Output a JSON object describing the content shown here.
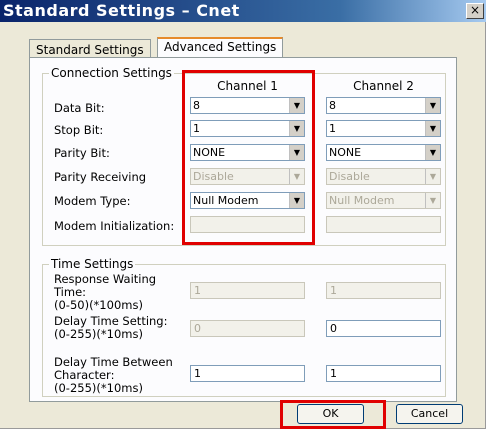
{
  "window": {
    "title": "Standard Settings – Cnet",
    "close_glyph": "×"
  },
  "tabs": [
    {
      "label": "Standard Settings",
      "selected": false
    },
    {
      "label": "Advanced Settings",
      "selected": true
    }
  ],
  "connection": {
    "group_title": "Connection Settings",
    "channel1_header": "Channel 1",
    "channel2_header": "Channel 2",
    "labels": {
      "data_bit": "Data Bit:",
      "stop_bit": "Stop Bit:",
      "parity_bit": "Parity Bit:",
      "parity_receiving": "Parity Receiving",
      "modem_type": "Modem Type:",
      "modem_init": "Modem Initialization:"
    },
    "channel1": {
      "data_bit": "8",
      "stop_bit": "1",
      "parity_bit": "NONE",
      "parity_receiving": "Disable",
      "modem_type": "Null Modem",
      "modem_init": ""
    },
    "channel2": {
      "data_bit": "8",
      "stop_bit": "1",
      "parity_bit": "NONE",
      "parity_receiving": "Disable",
      "modem_type": "Null Modem",
      "modem_init": ""
    }
  },
  "time": {
    "group_title": "Time Settings",
    "labels": {
      "response_waiting": "Response Waiting Time:\n(0-50)(*100ms)",
      "delay_time": "Delay Time Setting:\n(0-255)(*10ms)",
      "delay_between_char": "Delay Time Between Character:\n(0-255)(*10ms)"
    },
    "channel1": {
      "response_waiting": "1",
      "delay_time": "0",
      "delay_between_char": "1"
    },
    "channel2": {
      "response_waiting": "1",
      "delay_time": "0",
      "delay_between_char": "1"
    }
  },
  "buttons": {
    "ok": "OK",
    "cancel": "Cancel"
  },
  "icons": {
    "dropdown_arrow": "▼"
  },
  "colors": {
    "highlight": "#e00000",
    "title_bar": "#0a246a",
    "selected_tab_accent": "#e68b2c"
  }
}
